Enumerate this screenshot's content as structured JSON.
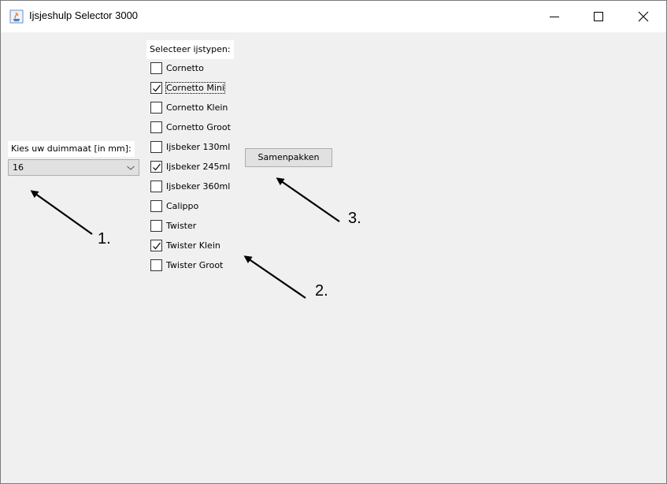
{
  "window": {
    "title": "Ijsjeshulp Selector 3000",
    "controls": {
      "minimize": "minimize-icon",
      "maximize": "maximize-icon",
      "close": "close-icon"
    }
  },
  "dimension": {
    "label": "Kies uw duimmaat [in mm]:",
    "selected": "16"
  },
  "types": {
    "label": "Selecteer ijstypen:",
    "items": [
      {
        "label": "Cornetto",
        "checked": false
      },
      {
        "label": "Cornetto Mini",
        "checked": true
      },
      {
        "label": "Cornetto Klein",
        "checked": false
      },
      {
        "label": "Cornetto Groot",
        "checked": false
      },
      {
        "label": "Ijsbeker 130ml",
        "checked": false
      },
      {
        "label": "Ijsbeker 245ml",
        "checked": true
      },
      {
        "label": "Ijsbeker 360ml",
        "checked": false
      },
      {
        "label": "Calippo",
        "checked": false
      },
      {
        "label": "Twister",
        "checked": false
      },
      {
        "label": "Twister Klein",
        "checked": true
      },
      {
        "label": "Twister Groot",
        "checked": false
      }
    ]
  },
  "pack_button": "Samenpakken",
  "annotations": [
    "1.",
    "2.",
    "3."
  ]
}
